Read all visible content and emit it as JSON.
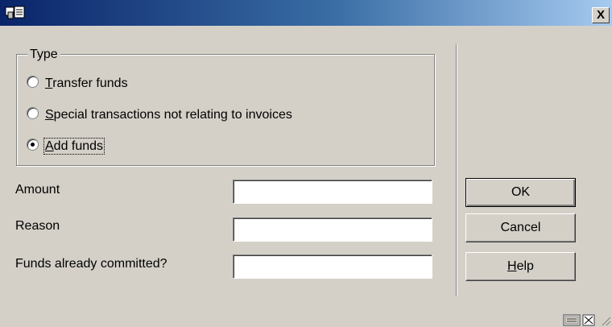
{
  "window": {
    "title_icon": "library-app-icon",
    "close_label": "X"
  },
  "type_group": {
    "legend": "Type",
    "options": [
      {
        "accel": "T",
        "rest": "ransfer funds",
        "checked": false
      },
      {
        "accel": "S",
        "rest": "pecial transactions not relating to invoices",
        "checked": false
      },
      {
        "accel": "A",
        "rest": "dd funds",
        "checked": true
      }
    ]
  },
  "form": {
    "fields": [
      {
        "label": "Amount",
        "value": ""
      },
      {
        "label": "Reason",
        "value": ""
      },
      {
        "label": "Funds already committed?",
        "value": ""
      }
    ]
  },
  "buttons": {
    "ok": "OK",
    "cancel": "Cancel",
    "help_accel": "H",
    "help_rest": "elp"
  },
  "status": {
    "icons": [
      "keyboard-icon",
      "resize-grip-icon"
    ]
  }
}
